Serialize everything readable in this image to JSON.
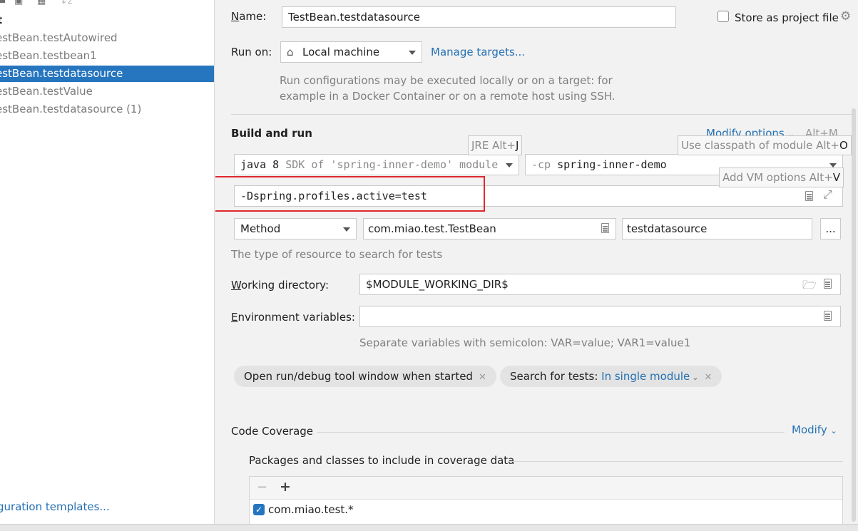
{
  "tree": {
    "root_label": "t",
    "items": [
      {
        "label": "estBean.testAutowired",
        "selected": false
      },
      {
        "label": "estBean.testbean1",
        "selected": false
      },
      {
        "label": "estBean.testdatasource",
        "selected": true
      },
      {
        "label": "estBean.testValue",
        "selected": false
      },
      {
        "label": "estBean.testdatasource (1)",
        "selected": false
      }
    ],
    "footer_link": "guration templates..."
  },
  "form": {
    "name_label": "Name:",
    "name_value": "TestBean.testdatasource",
    "store_label": "Store as project file",
    "run_on_label": "Run on:",
    "run_on_value": "Local machine",
    "manage_targets": "Manage targets...",
    "run_on_hint_1": "Run configurations may be executed locally or on a target: for",
    "run_on_hint_2": "example in a Docker Container or on a remote host using SSH.",
    "build_run_title": "Build and run",
    "modify_options": "Modify options",
    "modify_options_shortcut": "Alt+M",
    "jdk_value_prefix": "java 8",
    "jdk_value_suffix": "SDK of 'spring-inner-demo' module",
    "cp_prefix": "-cp",
    "cp_value": "spring-inner-demo",
    "vm_options_value": "-Dspring.profiles.active=test",
    "test_kind": "Method",
    "class_value": "com.miao.test.TestBean",
    "method_value": "testdatasource",
    "method_browse": "...",
    "resource_hint": "The type of resource to search for tests",
    "working_dir_label": "Working directory:",
    "working_dir_value": "$MODULE_WORKING_DIR$",
    "env_label": "Environment variables:",
    "env_value": "",
    "env_hint": "Separate variables with semicolon: VAR=value; VAR1=value1",
    "chip_open_tool": "Open run/debug tool window when started",
    "chip_search_label": "Search for tests:",
    "chip_search_value": "In single module",
    "code_coverage": "Code Coverage",
    "modify": "Modify",
    "packages_title": "Packages and classes to include in coverage data",
    "coverage_item": "com.miao.test.*"
  },
  "tooltips": {
    "jre_text": "JRE Alt+",
    "jre_key": "J",
    "classpath_text": "Use classpath of module Alt+",
    "classpath_key": "O",
    "vm_text": "Add VM options Alt+",
    "vm_key": "V"
  },
  "colors": {
    "selection": "#2675bf",
    "link": "#2470b3",
    "highlight_box": "#e0282e"
  }
}
